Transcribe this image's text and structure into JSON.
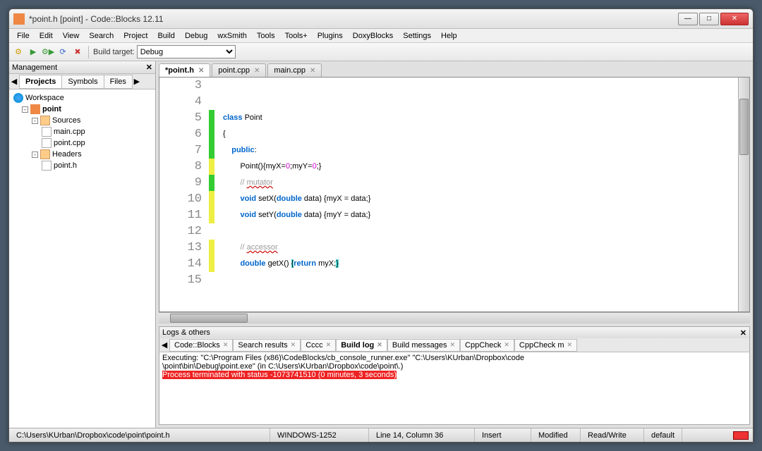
{
  "window": {
    "title": "*point.h [point] - Code::Blocks 12.11"
  },
  "menu": [
    "File",
    "Edit",
    "View",
    "Search",
    "Project",
    "Build",
    "Debug",
    "wxSmith",
    "Tools",
    "Tools+",
    "Plugins",
    "DoxyBlocks",
    "Settings",
    "Help"
  ],
  "toolbar": {
    "build_target_label": "Build target:",
    "build_target_value": "Debug"
  },
  "management": {
    "title": "Management",
    "tabs": [
      "Projects",
      "Symbols",
      "Files"
    ],
    "tree": {
      "workspace": "Workspace",
      "project": "point",
      "sources": "Sources",
      "source_files": [
        "main.cpp",
        "point.cpp"
      ],
      "headers": "Headers",
      "header_files": [
        "point.h"
      ]
    }
  },
  "file_tabs": [
    {
      "label": "*point.h",
      "active": true
    },
    {
      "label": "point.cpp",
      "active": false
    },
    {
      "label": "main.cpp",
      "active": false
    }
  ],
  "code": {
    "first_line": 3,
    "html_lines": [
      "",
      "",
      "<span class='kw'>class</span> Point",
      "{",
      "    <span class='kw'>public</span>:",
      "        Point(){myX=<span class='num'>0</span>;myY=<span class='num'>0</span>;}",
      "        <span class='cm'>// <span class='sq'>mutator</span></span>",
      "        <span class='kw'>void</span> setX(<span class='kw'>double</span> data) {myX = data;}",
      "        <span class='kw'>void</span> setY(<span class='kw'>double</span> data) {myY = data;}",
      "",
      "        <span class='cm'>// <span class='sq'>accessor</span></span>",
      "        <span class='kw'>double</span> getX() <span class='hl'>{</span><span class='kw'>return</span> myX;<span class='hl'>}</span>",
      ""
    ],
    "markers": [
      "",
      "",
      "g",
      "g",
      "g",
      "y",
      "g",
      "y",
      "y",
      "",
      "y",
      "y",
      ""
    ]
  },
  "logs": {
    "title": "Logs & others",
    "tabs": [
      "Code::Blocks",
      "Search results",
      "Cccc",
      "Build log",
      "Build messages",
      "CppCheck",
      "CppCheck m"
    ],
    "active_tab": 3,
    "line1": "Executing: \"C:\\Program Files (x86)\\CodeBlocks/cb_console_runner.exe\" \"C:\\Users\\KUrban\\Dropbox\\code",
    "line2": "\\point\\bin\\Debug\\point.exe\"  (in C:\\Users\\KUrban\\Dropbox\\code\\point\\.)",
    "error": "Process terminated with status -1073741510 (0 minutes, 3 seconds)"
  },
  "status": {
    "path": "C:\\Users\\KUrban\\Dropbox\\code\\point\\point.h",
    "encoding": "WINDOWS-1252",
    "position": "Line 14, Column 36",
    "mode": "Insert",
    "modified": "Modified",
    "rw": "Read/Write",
    "profile": "default"
  }
}
